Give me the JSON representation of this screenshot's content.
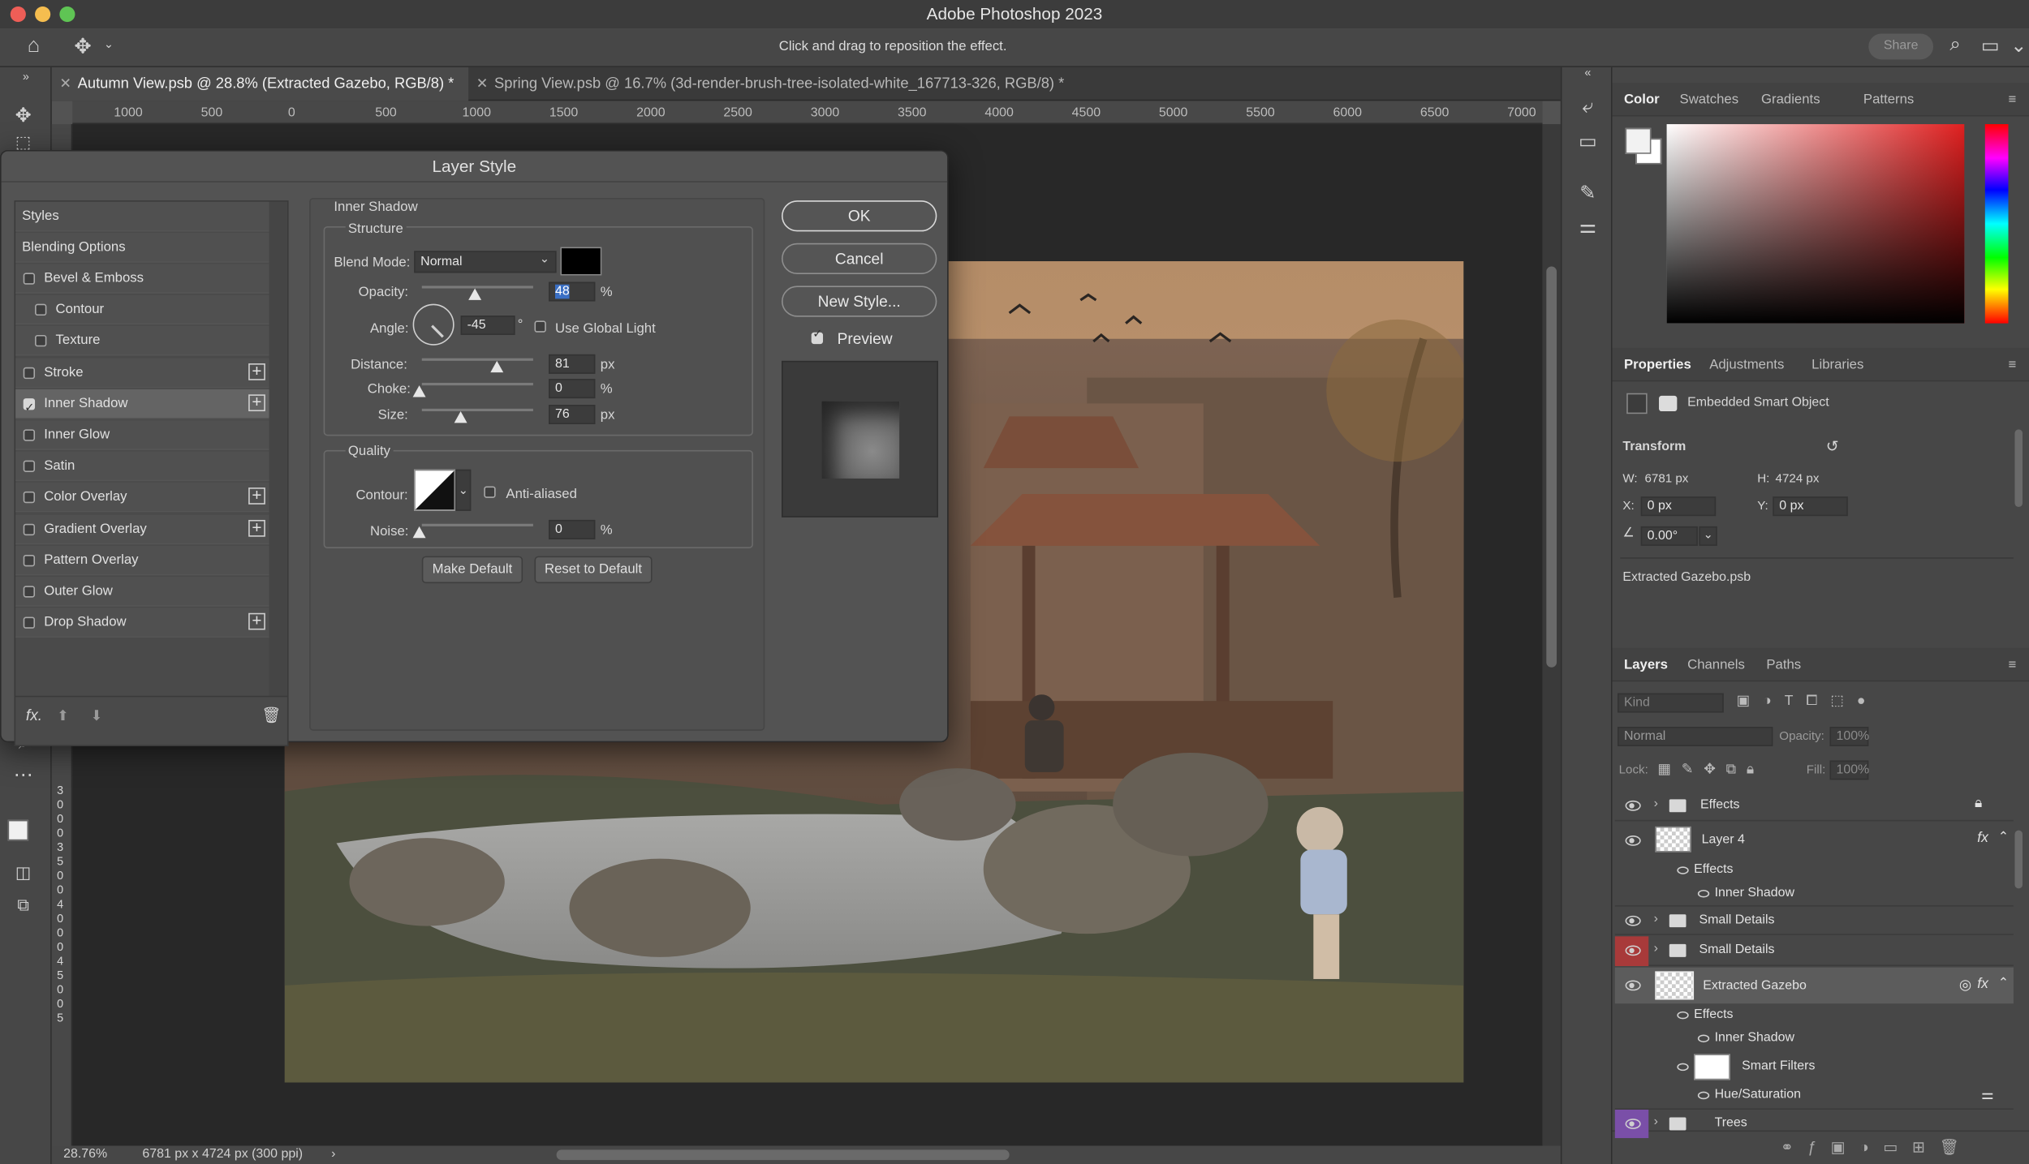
{
  "app": {
    "title": "Adobe Photoshop 2023",
    "hint": "Click and drag to reposition the effect.",
    "share_label": "Share"
  },
  "tabs": [
    {
      "label": "Autumn View.psb @ 28.8% (Extracted Gazebo, RGB/8) *",
      "active": true
    },
    {
      "label": "Spring View.psb @ 16.7% (3d-render-brush-tree-isolated-white_167713-326, RGB/8) *",
      "active": false
    }
  ],
  "ruler": {
    "top": [
      "1000",
      "500",
      "0",
      "500",
      "1000",
      "1500",
      "2000",
      "2500",
      "3000",
      "3500",
      "4000",
      "4500",
      "5000",
      "5500",
      "6000",
      "6500",
      "7000"
    ],
    "left": [
      "3",
      "0",
      "0",
      "0",
      "3",
      "5",
      "0",
      "0",
      "4",
      "0",
      "0",
      "0",
      "4",
      "5",
      "0",
      "0",
      "5"
    ]
  },
  "status": {
    "zoom": "28.76%",
    "info": "6781 px x 4724 px (300 ppi)"
  },
  "dialog": {
    "title": "Layer Style",
    "styles_header": "Styles",
    "blending_options": "Blending Options",
    "effects": [
      {
        "label": "Bevel & Emboss",
        "checked": false,
        "indent": false,
        "plus": false
      },
      {
        "label": "Contour",
        "checked": false,
        "indent": true,
        "plus": false
      },
      {
        "label": "Texture",
        "checked": false,
        "indent": true,
        "plus": false
      },
      {
        "label": "Stroke",
        "checked": false,
        "indent": false,
        "plus": true
      },
      {
        "label": "Inner Shadow",
        "checked": true,
        "indent": false,
        "plus": true
      },
      {
        "label": "Inner Glow",
        "checked": false,
        "indent": false,
        "plus": false
      },
      {
        "label": "Satin",
        "checked": false,
        "indent": false,
        "plus": false
      },
      {
        "label": "Color Overlay",
        "checked": false,
        "indent": false,
        "plus": true
      },
      {
        "label": "Gradient Overlay",
        "checked": false,
        "indent": false,
        "plus": true
      },
      {
        "label": "Pattern Overlay",
        "checked": false,
        "indent": false,
        "plus": false
      },
      {
        "label": "Outer Glow",
        "checked": false,
        "indent": false,
        "plus": false
      },
      {
        "label": "Drop Shadow",
        "checked": false,
        "indent": false,
        "plus": true
      }
    ],
    "fx_label": "fx.",
    "section_title": "Inner Shadow",
    "structure": {
      "title": "Structure",
      "blend_mode_label": "Blend Mode:",
      "blend_mode": "Normal",
      "opacity_label": "Opacity:",
      "opacity": "48",
      "opacity_unit": "%",
      "angle_label": "Angle:",
      "angle": "-45",
      "angle_unit": "°",
      "global_light_label": "Use Global Light",
      "distance_label": "Distance:",
      "distance": "81",
      "distance_unit": "px",
      "choke_label": "Choke:",
      "choke": "0",
      "choke_unit": "%",
      "size_label": "Size:",
      "size": "76",
      "size_unit": "px"
    },
    "quality": {
      "title": "Quality",
      "contour_label": "Contour:",
      "anti_aliased_label": "Anti-aliased",
      "noise_label": "Noise:",
      "noise": "0",
      "noise_unit": "%"
    },
    "make_default": "Make Default",
    "reset_default": "Reset to Default",
    "ok": "OK",
    "cancel": "Cancel",
    "new_style": "New Style...",
    "preview": "Preview"
  },
  "color_panel": {
    "tabs": [
      "Color",
      "Swatches",
      "Gradients",
      "Patterns"
    ],
    "hue_color": "#e02020"
  },
  "properties": {
    "tabs": [
      "Properties",
      "Adjustments",
      "Libraries"
    ],
    "type": "Embedded Smart Object",
    "transform_title": "Transform",
    "w_label": "W:",
    "w": "6781 px",
    "h_label": "H:",
    "h": "4724 px",
    "x_label": "X:",
    "x": "0 px",
    "y_label": "Y:",
    "y": "0 px",
    "angle": "0.00°",
    "file": "Extracted Gazebo.psb"
  },
  "layers_panel": {
    "tabs": [
      "Layers",
      "Channels",
      "Paths"
    ],
    "kind_placeholder": "Kind",
    "blend": "Normal",
    "opacity_label": "Opacity:",
    "opacity": "100%",
    "lock_label": "Lock:",
    "fill_label": "Fill:",
    "fill": "100%",
    "rows": {
      "effects_group": "Effects",
      "layer4": "Layer 4",
      "layer4_effects": "Effects",
      "layer4_inner_shadow": "Inner Shadow",
      "small_details_1": "Small Details",
      "small_details_2": "Small Details",
      "extracted_gazebo": "Extracted Gazebo",
      "gazebo_effects": "Effects",
      "gazebo_inner_shadow": "Inner Shadow",
      "smart_filters": "Smart Filters",
      "hue_saturation": "Hue/Saturation",
      "trees": "Trees"
    }
  }
}
